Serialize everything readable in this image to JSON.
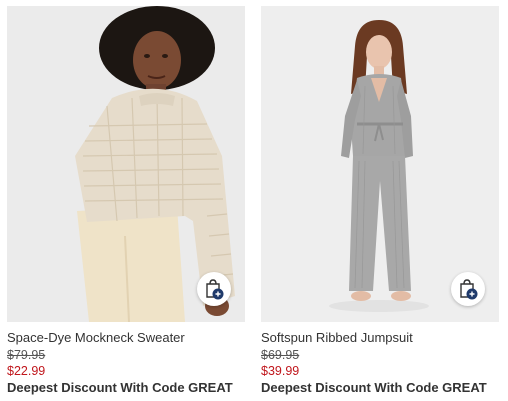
{
  "products": [
    {
      "name": "Space-Dye Mockneck Sweater",
      "original_price": "$79.95",
      "sale_price": "$22.99",
      "promo": "Deepest Discount With Code GREAT",
      "quick_add_icon": "shopping-bag-plus-icon"
    },
    {
      "name": "Softspun Ribbed Jumpsuit",
      "original_price": "$69.95",
      "sale_price": "$39.99",
      "promo": "Deepest Discount With Code GREAT",
      "quick_add_icon": "shopping-bag-plus-icon"
    }
  ],
  "colors": {
    "sale_price": "#c0161c",
    "text": "#333333",
    "bag_badge": "#1f3a6b"
  }
}
